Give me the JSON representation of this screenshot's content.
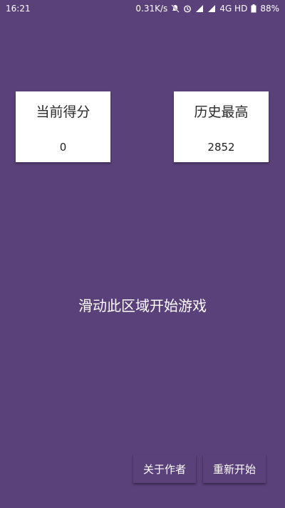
{
  "status_bar": {
    "time": "16:21",
    "net_speed": "0.31K/s",
    "network": "4G HD",
    "battery": "88%",
    "icons": [
      "mute-icon",
      "alarm-icon",
      "signal-icon",
      "signal-icon",
      "battery-icon"
    ]
  },
  "scores": {
    "current_label": "当前得分",
    "current_value": "0",
    "best_label": "历史最高",
    "best_value": "2852"
  },
  "game": {
    "hint": "滑动此区域开始游戏"
  },
  "buttons": {
    "about_label": "关于作者",
    "restart_label": "重新开始"
  },
  "colors": {
    "background": "#5a417a",
    "card": "#ffffff",
    "text_light": "#ffffff"
  }
}
